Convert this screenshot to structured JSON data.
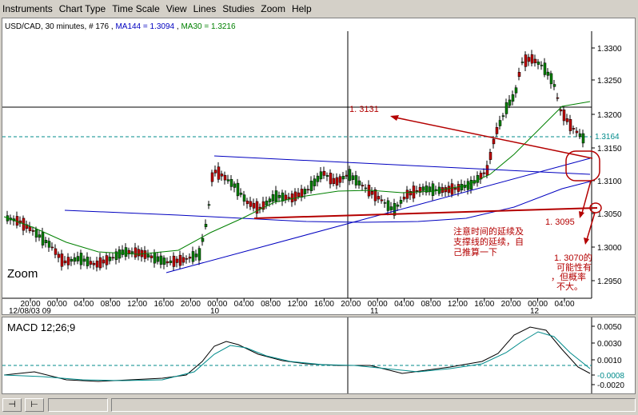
{
  "menu": [
    "Instruments",
    "Chart Type",
    "Time Scale",
    "View",
    "Lines",
    "Studies",
    "Zoom",
    "Help"
  ],
  "legend": {
    "symbol": "USD/CAD",
    "interval": "30 minutes",
    "bars": "# 176",
    "ma144_label": "MA144 = 1.3094",
    "ma30_label": "MA30 = 1.3216"
  },
  "price_axis": [
    "1.3300",
    "1.3250",
    "1.3200",
    "1.3150",
    "1.3100",
    "1.3050",
    "1.3000",
    "1.2950"
  ],
  "current_price": "1.3164",
  "time_axis": [
    "20:00",
    "00:00",
    "04:00",
    "08:00",
    "12:00",
    "16:00",
    "20:00",
    "00:00",
    "04:00",
    "08:00",
    "12:00",
    "16:00",
    "20:00",
    "00:00",
    "04:00",
    "08:00",
    "12:00",
    "16:00",
    "20:00",
    "00:00",
    "04:00"
  ],
  "date_labels": [
    "12/08/03  09",
    "10",
    "11",
    "12"
  ],
  "zoom_label": "Zoom",
  "annotations": {
    "level_1": "1. 3131",
    "level_2": "1. 3095",
    "level_3_lines": [
      "1. 3070的",
      "可能性有",
      "，但概率",
      "不大。"
    ],
    "note_lines": [
      "注意时间的延续及",
      "支撑线的延续，自",
      "己推算一下"
    ]
  },
  "macd": {
    "label": "MACD 12;26;9",
    "axis": [
      "0.0050",
      "0.0030",
      "0.0010",
      "-0.0008",
      "-0.0020"
    ]
  },
  "statusbar": {
    "btn1": "⊣",
    "btn2": "⊢"
  },
  "colors": {
    "annotation": "#b40000",
    "ma144": "#0000c0",
    "ma30": "#008000",
    "bull_candle": "#008000",
    "bear_candle": "#c00000",
    "macd_signal": "#008b8b"
  }
}
